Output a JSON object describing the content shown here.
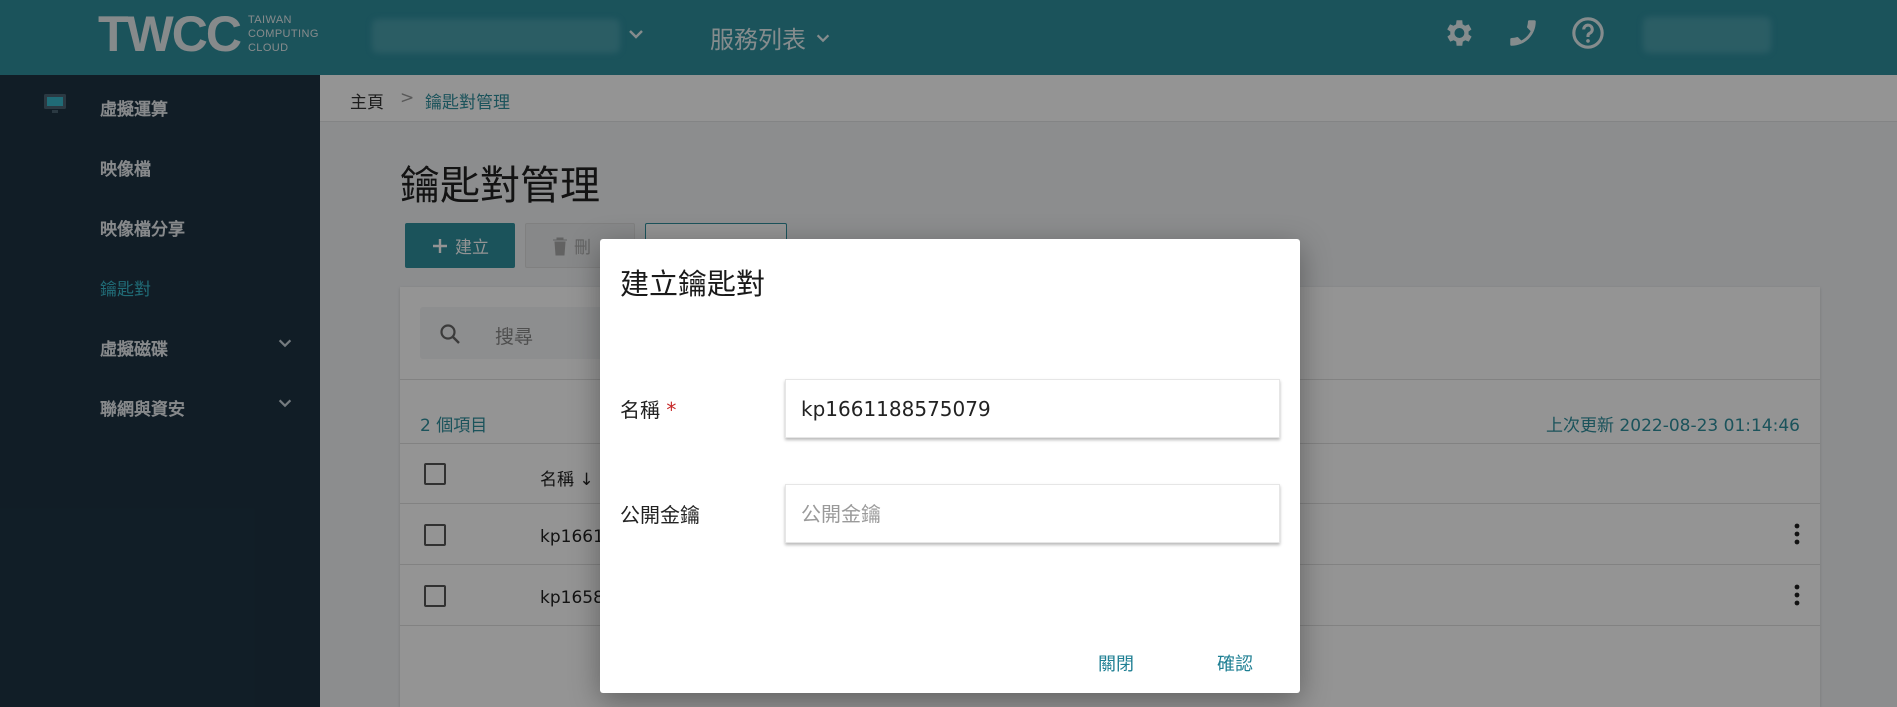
{
  "header": {
    "logo_mark": "TWCC",
    "logo_text_1": "TAIWAN",
    "logo_text_2": "COMPUTING",
    "logo_text_3": "CLOUD",
    "service_menu": "服務列表",
    "icons": [
      "gear-icon",
      "phone-icon",
      "help-icon"
    ]
  },
  "sidebar": {
    "items": [
      {
        "label": "虛擬運算"
      },
      {
        "label": "映像檔"
      },
      {
        "label": "映像檔分享"
      },
      {
        "label": "鑰匙對",
        "active": true
      },
      {
        "label": "虛擬磁碟"
      },
      {
        "label": "聯網與資安"
      }
    ]
  },
  "breadcrumb": {
    "home": "主頁",
    "separator": ">",
    "current": "鑰匙對管理"
  },
  "page": {
    "title": "鑰匙對管理",
    "create_label": "建立",
    "delete_label": "刪"
  },
  "list": {
    "search_placeholder": "搜尋",
    "count": "2 個項目",
    "updated": "上次更新 2022-08-23 01:14:46",
    "column_name": "名稱",
    "rows": [
      {
        "name": "kp1661"
      },
      {
        "name": "kp1658"
      }
    ]
  },
  "dialog": {
    "title": "建立鑰匙對",
    "name_label": "名稱",
    "required_mark": "*",
    "name_value": "kp1661188575079",
    "pubkey_label": "公開金鑰",
    "pubkey_placeholder": "公開金鑰",
    "close_label": "關閉",
    "confirm_label": "確認"
  },
  "colors": {
    "header": "#2f8f9e",
    "sidebar": "#1e3343",
    "accent": "#38b8cb",
    "dialog_button": "#1e7f93",
    "required": "#c62828"
  }
}
